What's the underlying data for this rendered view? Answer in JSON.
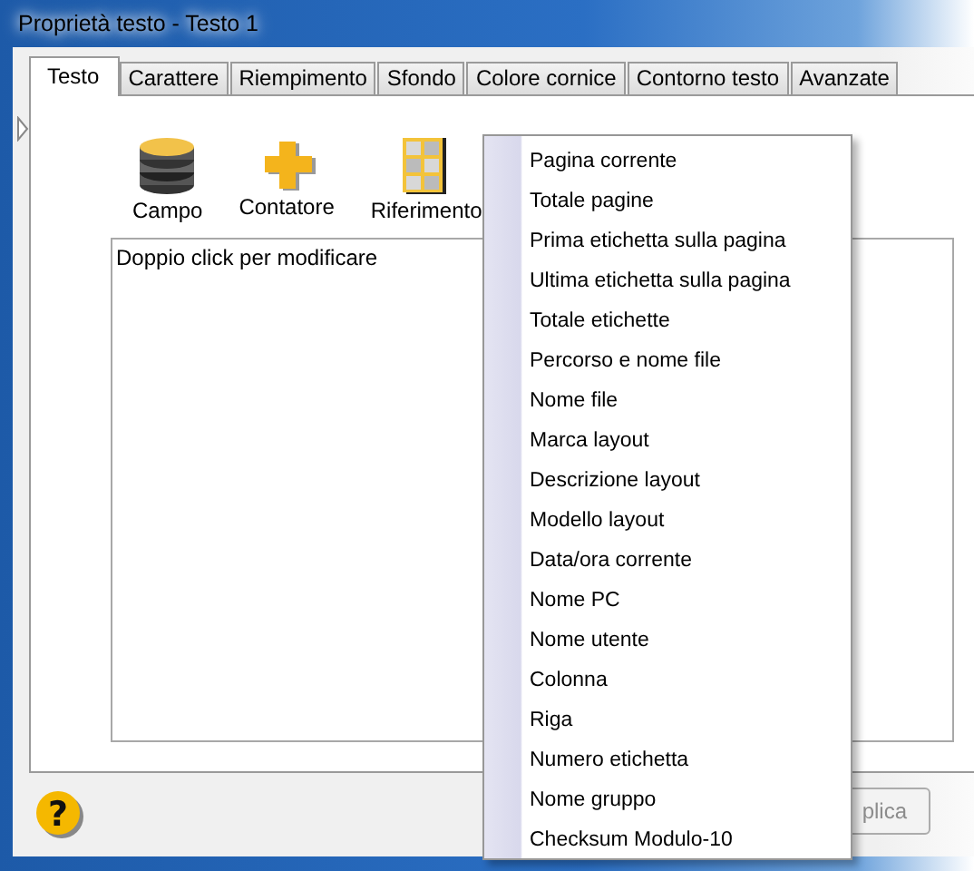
{
  "window": {
    "title": "Proprietà testo - Testo 1"
  },
  "tabs": [
    {
      "label": "Testo",
      "selected": true
    },
    {
      "label": "Carattere",
      "selected": false
    },
    {
      "label": "Riempimento",
      "selected": false
    },
    {
      "label": "Sfondo",
      "selected": false
    },
    {
      "label": "Colore cornice",
      "selected": false
    },
    {
      "label": "Contorno testo",
      "selected": false
    },
    {
      "label": "Avanzate",
      "selected": false
    }
  ],
  "toolbar": [
    {
      "label": "Campo",
      "kind": "database"
    },
    {
      "label": "Contatore",
      "kind": "plus"
    },
    {
      "label": "Riferimento",
      "kind": "grid"
    }
  ],
  "editor": {
    "value": "Doppio click per modificare"
  },
  "help": {
    "glyph": "?"
  },
  "buttons": [
    "plica"
  ],
  "menu": [
    "Pagina corrente",
    "Totale pagine",
    "Prima etichetta sulla pagina",
    "Ultima etichetta sulla pagina",
    "Totale etichette",
    "Percorso e nome file",
    "Nome file",
    "Marca layout",
    "Descrizione layout",
    "Modello layout",
    "Data/ora corrente",
    "Nome PC",
    "Nome utente",
    "Colonna",
    "Riga",
    "Numero etichetta",
    "Nome gruppo",
    "Checksum Modulo-10"
  ]
}
